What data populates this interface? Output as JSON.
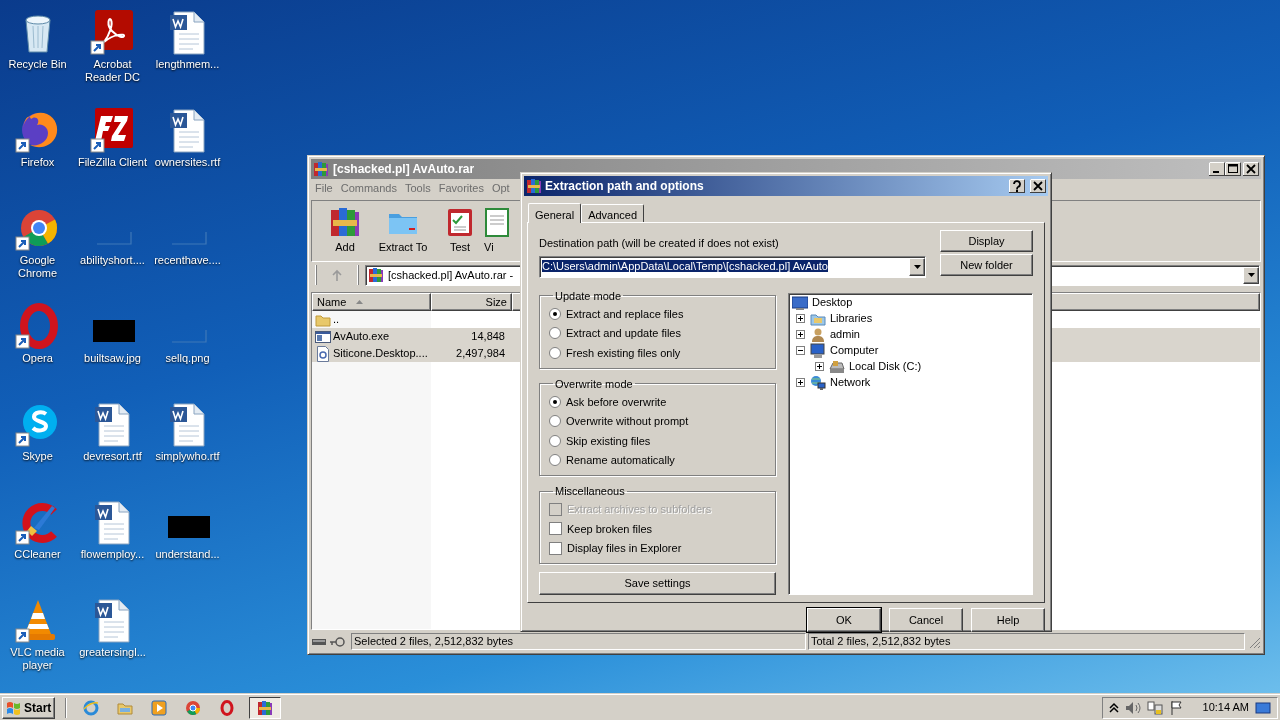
{
  "desktop": {
    "icons": [
      {
        "label": "Recycle Bin",
        "kind": "recycle",
        "shortcut": false
      },
      {
        "label": "Acrobat Reader DC",
        "kind": "pdf",
        "shortcut": true
      },
      {
        "label": "lengthmem...",
        "kind": "document",
        "shortcut": false
      },
      {
        "label": "Firefox",
        "kind": "firefox",
        "shortcut": true
      },
      {
        "label": "FileZilla Client",
        "kind": "filezilla",
        "shortcut": true
      },
      {
        "label": "ownersites.rtf",
        "kind": "document",
        "shortcut": false
      },
      {
        "label": "Google Chrome",
        "kind": "chrome",
        "shortcut": true
      },
      {
        "label": "abilityshort....",
        "kind": "blank",
        "shortcut": false
      },
      {
        "label": "recenthave....",
        "kind": "blank",
        "shortcut": false
      },
      {
        "label": "Opera",
        "kind": "opera",
        "shortcut": true
      },
      {
        "label": "builtsaw.jpg",
        "kind": "black",
        "shortcut": false
      },
      {
        "label": "sellq.png",
        "kind": "blank",
        "shortcut": false
      },
      {
        "label": "Skype",
        "kind": "skype",
        "shortcut": true
      },
      {
        "label": "devresort.rtf",
        "kind": "document",
        "shortcut": false
      },
      {
        "label": "simplywho.rtf",
        "kind": "document",
        "shortcut": false
      },
      {
        "label": "CCleaner",
        "kind": "ccleaner",
        "shortcut": true
      },
      {
        "label": "flowemploy...",
        "kind": "document",
        "shortcut": false
      },
      {
        "label": "understand...",
        "kind": "black",
        "shortcut": false
      },
      {
        "label": "VLC media player",
        "kind": "vlc",
        "shortcut": true
      },
      {
        "label": "greatersingl...",
        "kind": "document",
        "shortcut": false
      }
    ]
  },
  "archive_window": {
    "title": "[cshacked.pl] AvAuto.rar",
    "menu": [
      "File",
      "Commands",
      "Tools",
      "Favorites",
      "Opt"
    ],
    "toolbar": [
      {
        "label": "Add",
        "kind": "add"
      },
      {
        "label": "Extract To",
        "kind": "extract"
      },
      {
        "label": "Test",
        "kind": "test"
      },
      {
        "label": "Vi",
        "kind": "view"
      }
    ],
    "address": "[cshacked.pl] AvAuto.rar -",
    "columns": [
      {
        "label": "Name",
        "sorted": true
      },
      {
        "label": "Size",
        "sorted": false
      }
    ],
    "files": [
      {
        "name": "..",
        "kind": "parent",
        "selected": false
      },
      {
        "name": "AvAuto.exe",
        "size": "14,848",
        "kind": "exe",
        "selected": true
      },
      {
        "name": "Siticone.Desktop....",
        "size": "2,497,984",
        "kind": "dll",
        "selected": true
      }
    ],
    "status_left": "Selected 2 files, 2,512,832 bytes",
    "status_right": "Total 2 files, 2,512,832 bytes"
  },
  "dialog": {
    "title": "Extraction path and options",
    "tabs": [
      {
        "label": "General",
        "selected": true
      },
      {
        "label": "Advanced",
        "selected": false
      }
    ],
    "destination_label": "Destination path (will be created if does not exist)",
    "destination_value": "C:\\Users\\admin\\AppData\\Local\\Temp\\[cshacked.pl] AvAuto",
    "side_buttons": [
      "Display",
      "New folder"
    ],
    "update_mode": {
      "title": "Update mode",
      "options": [
        {
          "label": "Extract and replace files",
          "selected": true
        },
        {
          "label": "Extract and update files",
          "selected": false
        },
        {
          "label": "Fresh existing files only",
          "selected": false
        }
      ]
    },
    "overwrite_mode": {
      "title": "Overwrite mode",
      "options": [
        {
          "label": "Ask before overwrite",
          "selected": true
        },
        {
          "label": "Overwrite without prompt",
          "selected": false
        },
        {
          "label": "Skip existing files",
          "selected": false
        },
        {
          "label": "Rename automatically",
          "selected": false
        }
      ]
    },
    "miscellaneous": {
      "title": "Miscellaneous",
      "options": [
        {
          "label": "Extract archives to subfolders",
          "checked": false,
          "disabled": true
        },
        {
          "label": "Keep broken files",
          "checked": false,
          "disabled": false
        },
        {
          "label": "Display files in Explorer",
          "checked": false,
          "disabled": false
        }
      ]
    },
    "save_button": "Save settings",
    "tree": [
      {
        "label": "Desktop",
        "kind": "desktop",
        "children": [
          {
            "label": "Libraries",
            "kind": "library",
            "expanded": false
          },
          {
            "label": "admin",
            "kind": "user",
            "expanded": false
          },
          {
            "label": "Computer",
            "kind": "computer",
            "expanded": true,
            "children": [
              {
                "label": "Local Disk (C:)",
                "kind": "drive",
                "expanded": false
              }
            ]
          },
          {
            "label": "Network",
            "kind": "network",
            "expanded": false
          }
        ]
      }
    ],
    "buttons": [
      {
        "label": "OK",
        "default": true
      },
      {
        "label": "Cancel",
        "default": false
      },
      {
        "label": "Help",
        "default": false
      }
    ]
  },
  "taskbar": {
    "start": "Start",
    "apps": [
      {
        "kind": "ie",
        "active": false
      },
      {
        "kind": "explorer",
        "active": false
      },
      {
        "kind": "media",
        "active": false
      },
      {
        "kind": "chrome",
        "active": false
      },
      {
        "kind": "opera",
        "active": false
      },
      {
        "kind": "winrar",
        "active": true
      }
    ],
    "clock": "10:14 AM"
  }
}
